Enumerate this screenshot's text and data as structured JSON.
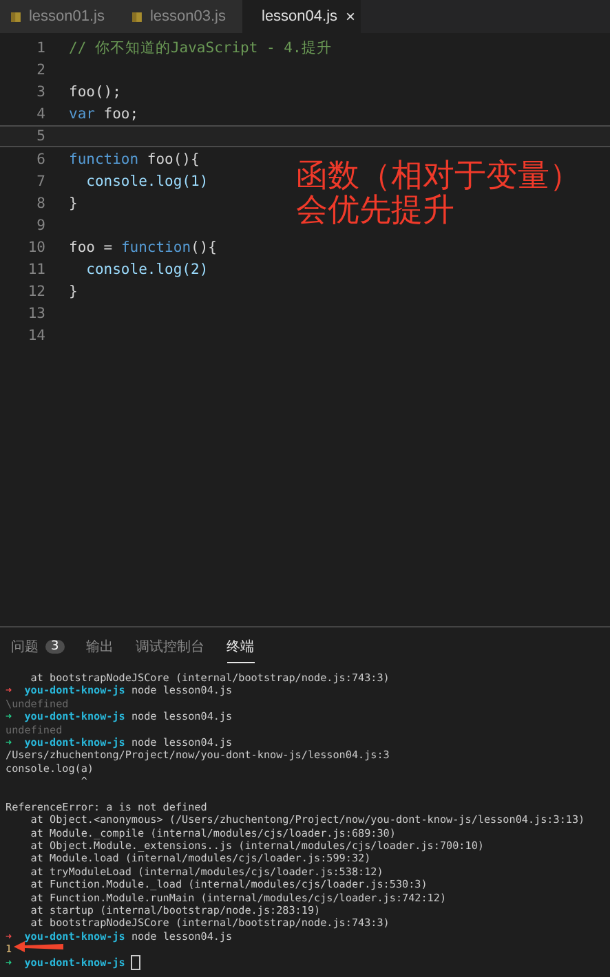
{
  "tabs": [
    {
      "label": "lesson01.js",
      "selected": false
    },
    {
      "label": "lesson03.js",
      "selected": false
    },
    {
      "label": "lesson04.js",
      "selected": true,
      "close": "×"
    }
  ],
  "editor": {
    "lines": [
      {
        "number": "1",
        "current": false,
        "segments": [
          {
            "text": "// 你不知道的JavaScript - 4.提升",
            "kind": "comment"
          }
        ]
      },
      {
        "number": "2",
        "current": false
      },
      {
        "number": "3",
        "current": false,
        "segments": [
          {
            "text": "foo();",
            "kind": "plain"
          }
        ]
      },
      {
        "number": "4",
        "current": false,
        "segments": [
          {
            "text": "var",
            "kind": "keyword"
          },
          {
            "text": " foo;",
            "kind": "plain"
          }
        ]
      },
      {
        "number": "5",
        "current": true
      },
      {
        "number": "6",
        "current": false,
        "segments": [
          {
            "text": "function",
            "kind": "keyword"
          },
          {
            "text": " foo(){",
            "kind": "plain"
          }
        ]
      },
      {
        "number": "7",
        "current": false,
        "segments": [
          {
            "text": "  console.log(1)",
            "kind": "call"
          }
        ]
      },
      {
        "number": "8",
        "current": false,
        "segments": [
          {
            "text": "}",
            "kind": "plain"
          }
        ]
      },
      {
        "number": "9",
        "current": false
      },
      {
        "number": "10",
        "current": false,
        "segments": [
          {
            "text": "foo = ",
            "kind": "plain"
          },
          {
            "text": "function",
            "kind": "keyword"
          },
          {
            "text": "(){",
            "kind": "plain"
          }
        ]
      },
      {
        "number": "11",
        "current": false,
        "segments": [
          {
            "text": "  console.log(2)",
            "kind": "call"
          }
        ]
      },
      {
        "number": "12",
        "current": false,
        "segments": [
          {
            "text": "}",
            "kind": "plain"
          }
        ]
      },
      {
        "number": "13",
        "current": false
      },
      {
        "number": "14",
        "current": false
      }
    ],
    "annotation": [
      "函数（相对于变量）",
      "会优先提升"
    ]
  },
  "panel": {
    "tabs": [
      {
        "label": "问题",
        "badge": "3",
        "selected": false
      },
      {
        "label": "输出",
        "selected": false
      },
      {
        "label": "调试控制台",
        "selected": false
      },
      {
        "label": "终端",
        "selected": true
      }
    ],
    "terminal": [
      {
        "kind": "text",
        "text": "    at bootstrapNodeJSCore (internal/bootstrap/node.js:743:3)"
      },
      {
        "kind": "prompt",
        "failed": true,
        "arrow": "➜",
        "dir": "you-dont-know-js",
        "command": "node lesson04.js"
      },
      {
        "kind": "muted",
        "text": "\\undefined"
      },
      {
        "kind": "prompt",
        "failed": false,
        "arrow": "➜",
        "dir": "you-dont-know-js",
        "command": "node lesson04.js"
      },
      {
        "kind": "muted",
        "text": "undefined"
      },
      {
        "kind": "prompt",
        "failed": false,
        "arrow": "➜",
        "dir": "you-dont-know-js",
        "command": "node lesson04.js"
      },
      {
        "kind": "text",
        "text": "/Users/zhuchentong/Project/now/you-dont-know-js/lesson04.js:3"
      },
      {
        "kind": "text",
        "text": "console.log(a)"
      },
      {
        "kind": "text",
        "text": "            ^"
      },
      {
        "kind": "blank"
      },
      {
        "kind": "text",
        "text": "ReferenceError: a is not defined"
      },
      {
        "kind": "text",
        "text": "    at Object.<anonymous> (/Users/zhuchentong/Project/now/you-dont-know-js/lesson04.js:3:13)"
      },
      {
        "kind": "text",
        "text": "    at Module._compile (internal/modules/cjs/loader.js:689:30)"
      },
      {
        "kind": "text",
        "text": "    at Object.Module._extensions..js (internal/modules/cjs/loader.js:700:10)"
      },
      {
        "kind": "text",
        "text": "    at Module.load (internal/modules/cjs/loader.js:599:32)"
      },
      {
        "kind": "text",
        "text": "    at tryModuleLoad (internal/modules/cjs/loader.js:538:12)"
      },
      {
        "kind": "text",
        "text": "    at Function.Module._load (internal/modules/cjs/loader.js:530:3)"
      },
      {
        "kind": "text",
        "text": "    at Function.Module.runMain (internal/modules/cjs/loader.js:742:12)"
      },
      {
        "kind": "text",
        "text": "    at startup (internal/bootstrap/node.js:283:19)"
      },
      {
        "kind": "text",
        "text": "    at bootstrapNodeJSCore (internal/bootstrap/node.js:743:3)"
      },
      {
        "kind": "prompt",
        "failed": true,
        "arrow": "➜",
        "dir": "you-dont-know-js",
        "command": "node lesson04.js"
      },
      {
        "kind": "output",
        "text": "1"
      },
      {
        "kind": "input",
        "failed": false,
        "arrow": "➜",
        "dir": "you-dont-know-js"
      }
    ]
  }
}
